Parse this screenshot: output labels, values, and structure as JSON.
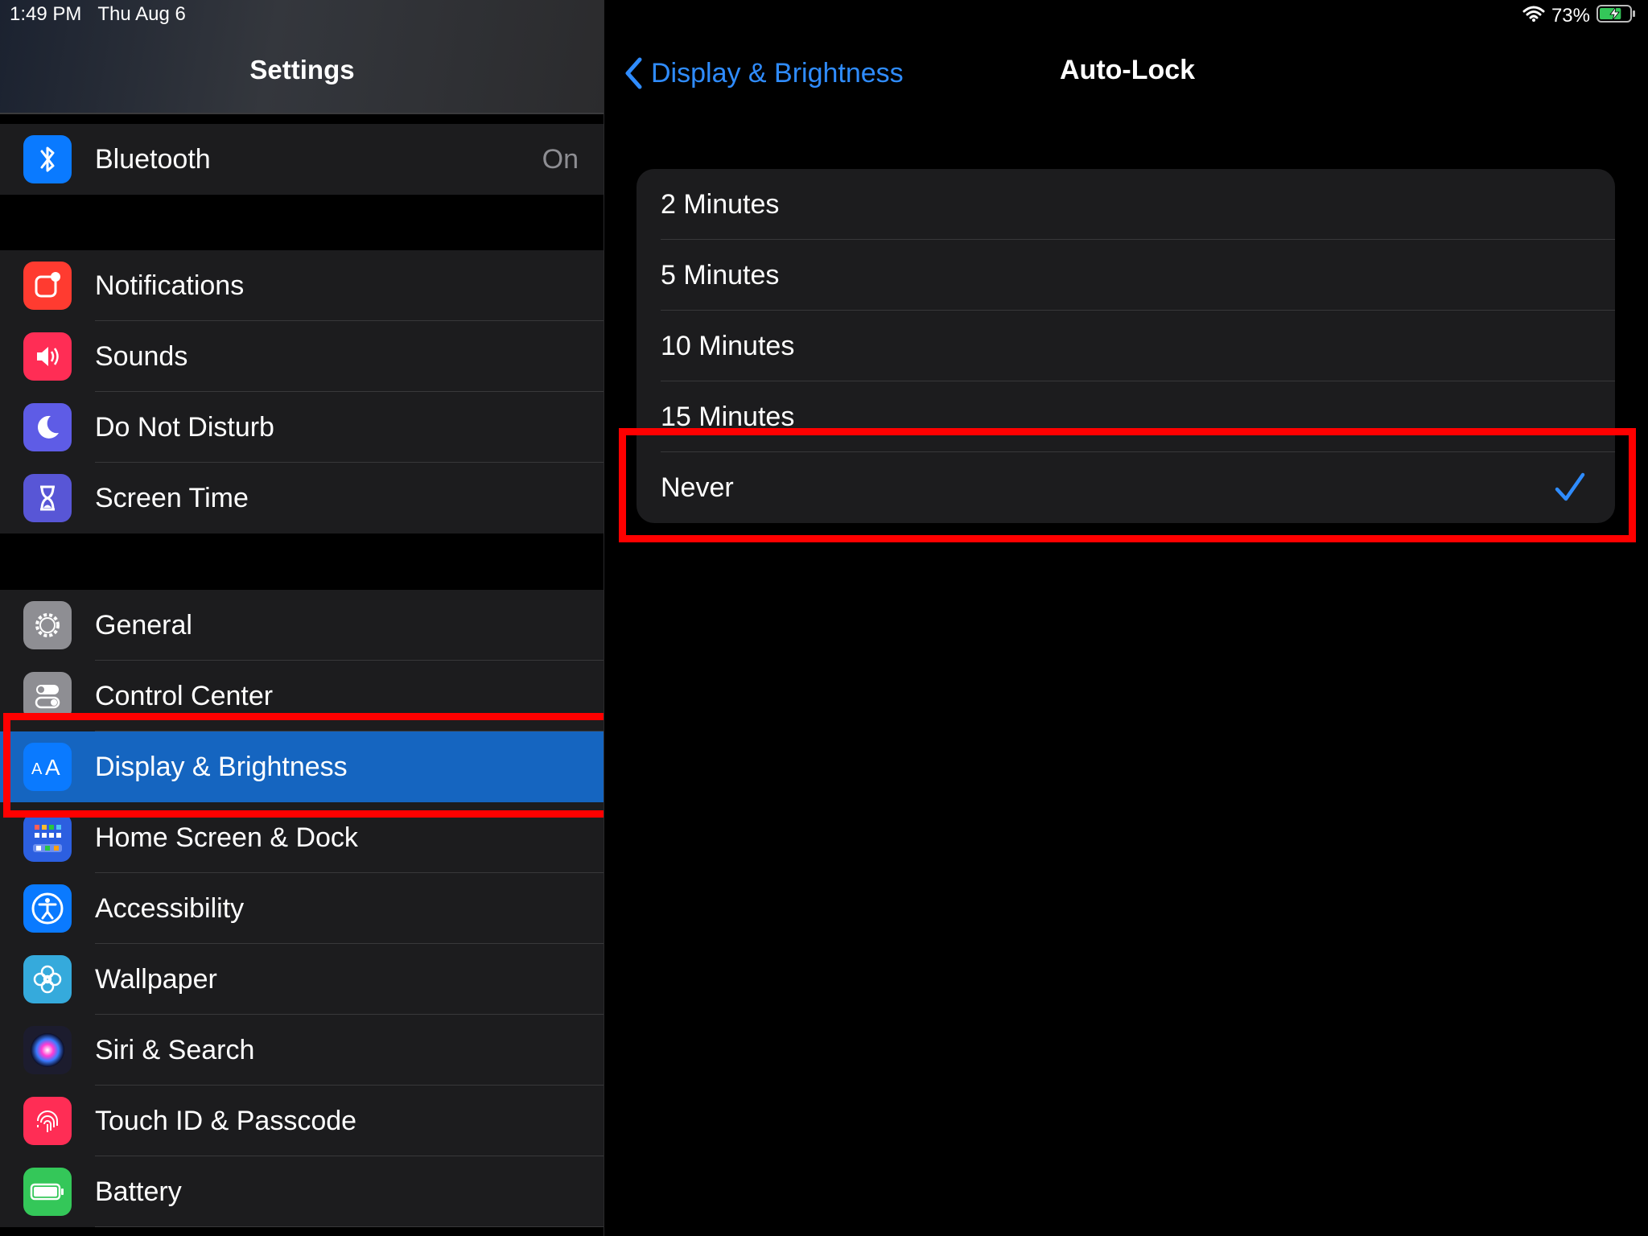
{
  "status_bar": {
    "time": "1:49 PM",
    "date": "Thu Aug 6",
    "battery_percent": "73%",
    "battery_level": 0.73,
    "charging": true
  },
  "sidebar": {
    "title": "Settings",
    "groups": [
      {
        "items": [
          {
            "label": "Bluetooth",
            "value": "On",
            "icon": "bluetooth-icon",
            "color": "#0a7aff"
          }
        ]
      },
      {
        "items": [
          {
            "label": "Notifications",
            "icon": "notifications-icon",
            "color": "#ff3b30"
          },
          {
            "label": "Sounds",
            "icon": "speaker-icon",
            "color": "#ff2d55"
          },
          {
            "label": "Do Not Disturb",
            "icon": "moon-icon",
            "color": "#5e5ce6"
          },
          {
            "label": "Screen Time",
            "icon": "hourglass-icon",
            "color": "#5856d6"
          }
        ]
      },
      {
        "items": [
          {
            "label": "General",
            "icon": "gear-icon",
            "color": "#8e8e93"
          },
          {
            "label": "Control Center",
            "icon": "toggles-icon",
            "color": "#8e8e93"
          },
          {
            "label": "Display & Brightness",
            "icon": "text-size-icon",
            "color": "#0a7aff",
            "selected": true
          },
          {
            "label": "Home Screen & Dock",
            "icon": "home-grid-icon",
            "color": "#2c5fe0"
          },
          {
            "label": "Accessibility",
            "icon": "accessibility-icon",
            "color": "#0a7aff"
          },
          {
            "label": "Wallpaper",
            "icon": "flower-icon",
            "color": "#35aadc"
          },
          {
            "label": "Siri & Search",
            "icon": "siri-icon",
            "color": "#1c1c2e"
          },
          {
            "label": "Touch ID & Passcode",
            "icon": "fingerprint-icon",
            "color": "#ff2d55"
          },
          {
            "label": "Battery",
            "icon": "battery-icon",
            "color": "#34c759"
          }
        ]
      }
    ]
  },
  "detail": {
    "back_label": "Display & Brightness",
    "title": "Auto-Lock",
    "options": [
      {
        "label": "2 Minutes",
        "selected": false
      },
      {
        "label": "5 Minutes",
        "selected": false
      },
      {
        "label": "10 Minutes",
        "selected": false
      },
      {
        "label": "15 Minutes",
        "selected": false
      },
      {
        "label": "Never",
        "selected": true
      }
    ]
  },
  "colors": {
    "accent": "#2f8cff",
    "selection": "#1565c0",
    "highlight": "#ff0000",
    "cell_bg": "#1c1c1e"
  }
}
